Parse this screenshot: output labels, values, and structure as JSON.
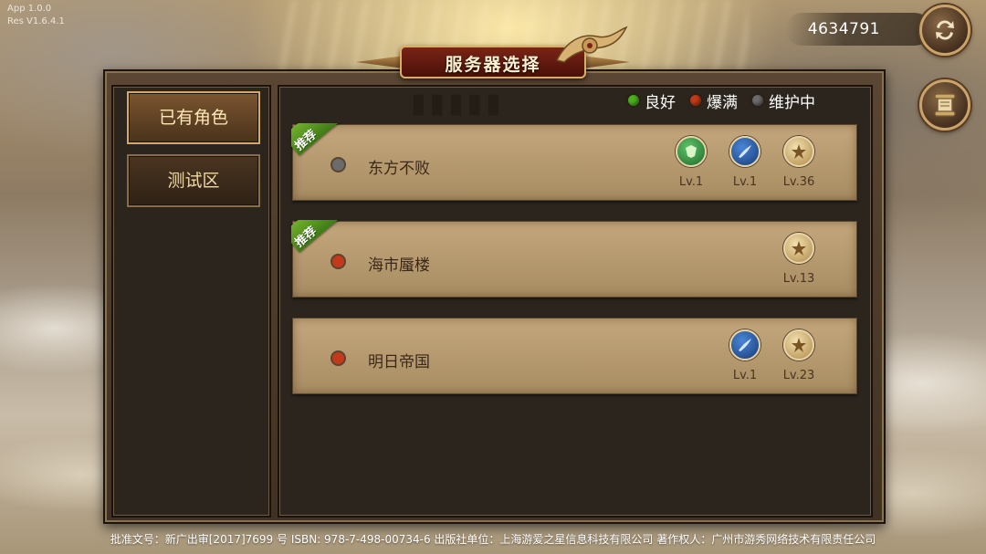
{
  "version": {
    "app": "App 1.0.0",
    "res": "Res V1.6.4.1"
  },
  "currency": {
    "value": "4634791",
    "refresh_icon": "refresh-icon",
    "scroll_icon": "scroll-icon"
  },
  "title": "服务器选择",
  "categories": [
    {
      "label": "已有角色",
      "active": true
    },
    {
      "label": "测试区",
      "active": false
    }
  ],
  "legend": [
    {
      "label": "良好",
      "color": "#4caf1f"
    },
    {
      "label": "爆满",
      "color": "#c23a1a"
    },
    {
      "label": "维护中",
      "color": "#6b6b6b"
    }
  ],
  "servers": [
    {
      "name": "东方不败",
      "status_color": "#6b6b6b",
      "recommended": "推荐",
      "characters": [
        {
          "class_icon": "green-mage-icon",
          "level": "Lv.1",
          "color": "#2f8a3a"
        },
        {
          "class_icon": "blue-blade-icon",
          "level": "Lv.1",
          "color": "#1f4f9a"
        },
        {
          "class_icon": "gold-warrior-icon",
          "level": "Lv.36",
          "color": "#c9a25a"
        }
      ]
    },
    {
      "name": "海市蜃楼",
      "status_color": "#c23a1a",
      "recommended": "推荐",
      "characters": [
        {
          "class_icon": "gold-warrior-icon",
          "level": "Lv.13",
          "color": "#c9a25a"
        }
      ]
    },
    {
      "name": "明日帝国",
      "status_color": "#c23a1a",
      "recommended": "",
      "characters": [
        {
          "class_icon": "blue-blade-icon",
          "level": "Lv.1",
          "color": "#1f4f9a"
        },
        {
          "class_icon": "gold-warrior-icon",
          "level": "Lv.23",
          "color": "#c9a25a"
        }
      ]
    }
  ],
  "footer": "批准文号：新广出审[2017]7699 号    ISBN: 978-7-498-00734-6    出版社单位：上海游爱之星信息科技有限公司    著作权人：广州市游秀网络技术有限责任公司"
}
